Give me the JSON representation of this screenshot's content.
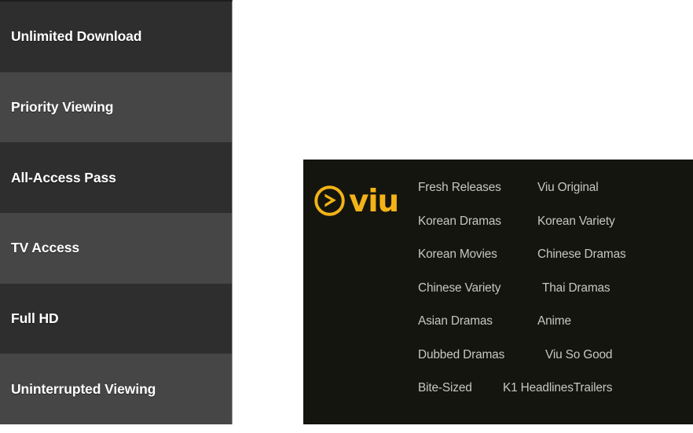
{
  "sidebar": {
    "name": "membership-benefits-list",
    "row_color_dark": "#2e2e2e",
    "row_color_light": "#464646",
    "text_color": "#ffffff",
    "items": [
      {
        "label": "Unlimited Download",
        "shade": "dark"
      },
      {
        "label": "Priority Viewing",
        "shade": "light"
      },
      {
        "label": "All-Access Pass",
        "shade": "dark"
      },
      {
        "label": "TV Access",
        "shade": "light"
      },
      {
        "label": "Full HD",
        "shade": "dark"
      },
      {
        "label": "Uninterrupted Viewing",
        "shade": "light"
      }
    ]
  },
  "footer_panel": {
    "background_color": "#15150f",
    "brand": {
      "wordmark": "viu",
      "color": "#F2B318",
      "icon": "play-circle-icon"
    },
    "link_text_color": "#c7c7c1",
    "link_rows": [
      [
        "Fresh Releases",
        "Viu Original"
      ],
      [
        "Korean Dramas",
        "Korean Variety"
      ],
      [
        "Korean Movies",
        "Chinese Dramas"
      ],
      [
        "Chinese Variety",
        "Thai Dramas"
      ],
      [
        "Asian Dramas",
        "Anime"
      ],
      [
        "Dubbed Dramas",
        "Viu So Good"
      ],
      [
        "Bite-Sized",
        "K1 Headlines",
        "Trailers"
      ]
    ]
  }
}
